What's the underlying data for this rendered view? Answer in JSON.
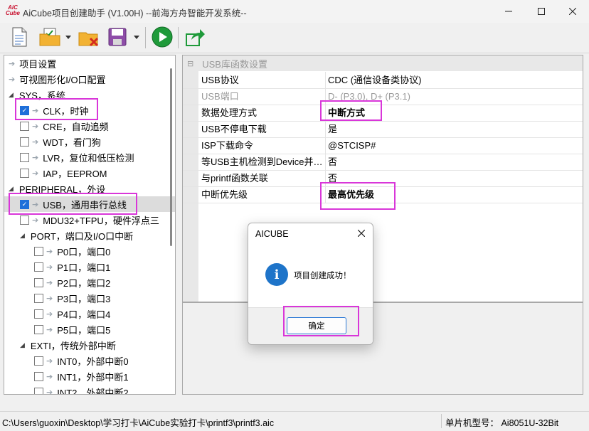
{
  "window": {
    "logo_text": "AiC Cube",
    "title": "AiCube项目创建助手 (V1.00H) --前海方舟智能开发系统--"
  },
  "toolbar": {
    "buttons": [
      {
        "name": "new-document-icon"
      },
      {
        "name": "open-project-icon"
      },
      {
        "name": "close-project-icon"
      },
      {
        "name": "save-icon"
      },
      {
        "name": "run-icon"
      },
      {
        "name": "export-icon"
      }
    ]
  },
  "tree": {
    "items": [
      {
        "label": "项目设置",
        "kind": "arrow",
        "indent": 0
      },
      {
        "label": "可视图形化I/O口配置",
        "kind": "arrow",
        "indent": 0
      },
      {
        "label": "SYS，系统",
        "kind": "expanded",
        "indent": 0
      },
      {
        "label": "CLK，时钟",
        "kind": "check",
        "checked": true,
        "indent": 1
      },
      {
        "label": "CRE，自动追频",
        "kind": "check",
        "checked": false,
        "indent": 1
      },
      {
        "label": "WDT，看门狗",
        "kind": "check",
        "checked": false,
        "indent": 1
      },
      {
        "label": "LVR，复位和低压检测",
        "kind": "check",
        "checked": false,
        "indent": 1
      },
      {
        "label": "IAP，EEPROM",
        "kind": "check",
        "checked": false,
        "indent": 1
      },
      {
        "label": "PERIPHERAL，外设",
        "kind": "expanded",
        "indent": 0
      },
      {
        "label": "USB，通用串行总线",
        "kind": "check",
        "checked": true,
        "indent": 1,
        "selected": true
      },
      {
        "label": "MDU32+TFPU，硬件浮点三",
        "kind": "check",
        "checked": false,
        "indent": 1
      },
      {
        "label": "PORT，端口及I/O口中断",
        "kind": "expanded",
        "indent": 1
      },
      {
        "label": "P0口，端口0",
        "kind": "check",
        "checked": false,
        "indent": 2
      },
      {
        "label": "P1口，端口1",
        "kind": "check",
        "checked": false,
        "indent": 2
      },
      {
        "label": "P2口，端口2",
        "kind": "check",
        "checked": false,
        "indent": 2
      },
      {
        "label": "P3口，端口3",
        "kind": "check",
        "checked": false,
        "indent": 2
      },
      {
        "label": "P4口，端口4",
        "kind": "check",
        "checked": false,
        "indent": 2
      },
      {
        "label": "P5口，端口5",
        "kind": "check",
        "checked": false,
        "indent": 2
      },
      {
        "label": "EXTI，传统外部中断",
        "kind": "expanded",
        "indent": 1
      },
      {
        "label": "INT0，外部中断0",
        "kind": "check",
        "checked": false,
        "indent": 2
      },
      {
        "label": "INT1，外部中断1",
        "kind": "check",
        "checked": false,
        "indent": 2
      },
      {
        "label": "INT2，外部中断2",
        "kind": "check",
        "checked": false,
        "indent": 2
      }
    ]
  },
  "properties": {
    "header": "USB库函数设置",
    "rows": [
      {
        "name": "USB协议",
        "value": "CDC (通信设备类协议)",
        "disabled": false
      },
      {
        "name": "USB端口",
        "value": "D- (P3.0), D+ (P3.1)",
        "disabled": true
      },
      {
        "name": "数据处理方式",
        "value": "中断方式",
        "bold": true
      },
      {
        "name": "USB不停电下载",
        "value": "是"
      },
      {
        "name": "ISP下载命令",
        "value": "@STCISP#"
      },
      {
        "name": "等USB主机检测到Device并…",
        "value": "否"
      },
      {
        "name": "与printf函数关联",
        "value": "否"
      },
      {
        "name": "中断优先级",
        "value": "最高优先级",
        "bold": true
      }
    ]
  },
  "dialog": {
    "title": "AICUBE",
    "message": "项目创建成功！",
    "ok_label": "确定"
  },
  "status": {
    "path": "C:\\Users\\guoxin\\Desktop\\学习打卡\\AiCube实验打卡\\printf3\\printf3.aic",
    "mcu": "单片机型号：   Ai8051U-32Bit"
  },
  "colors": {
    "highlight": "#d936d9",
    "checkbox_on": "#1e6fd9",
    "info_icon": "#1e74c9"
  }
}
